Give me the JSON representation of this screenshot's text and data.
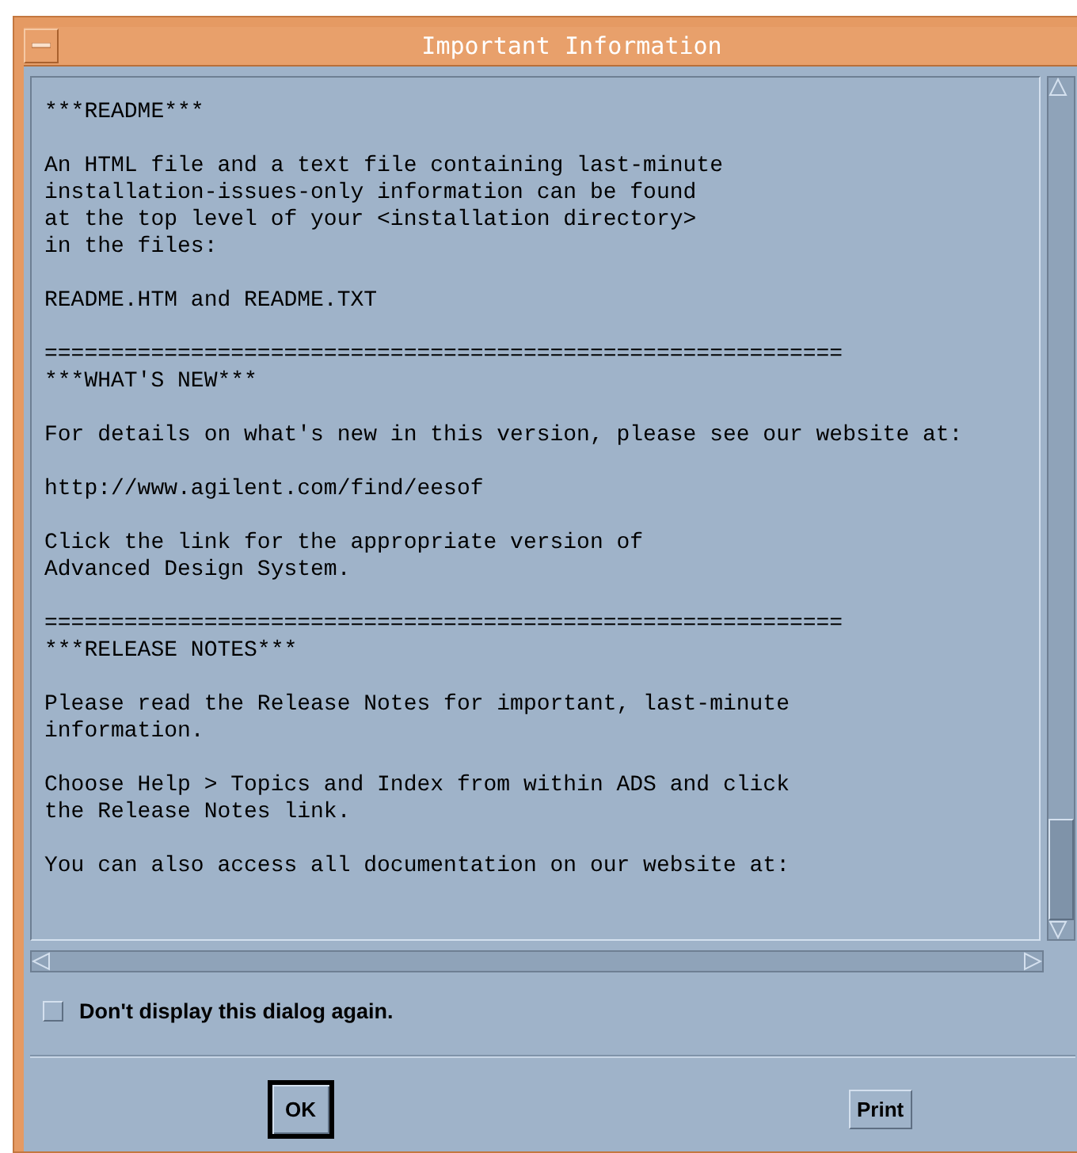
{
  "window": {
    "title": "Important Information"
  },
  "content": [
    {
      "kind": "text",
      "text": "***README***"
    },
    {
      "kind": "text",
      "text": "An HTML file and a text file containing last-minute\ninstallation-issues-only information can be found\nat the top level of your <installation directory>\nin the files:"
    },
    {
      "kind": "text",
      "text": "README.HTM and README.TXT"
    },
    {
      "kind": "rule",
      "text": "============================================================"
    },
    {
      "kind": "heading",
      "text": "***WHAT'S NEW***"
    },
    {
      "kind": "text",
      "text": "For details on what's new in this version, please see our website at:"
    },
    {
      "kind": "link",
      "text": "http://www.agilent.com/find/eesof"
    },
    {
      "kind": "text",
      "text": "Click the link for the appropriate version of\nAdvanced Design System."
    },
    {
      "kind": "rule",
      "text": "============================================================"
    },
    {
      "kind": "heading",
      "text": "***RELEASE NOTES***"
    },
    {
      "kind": "text",
      "text": "Please read the Release Notes for important, last-minute\ninformation."
    },
    {
      "kind": "text",
      "text": "Choose Help > Topics and Index from within ADS and click\nthe Release Notes link."
    },
    {
      "kind": "text",
      "text": "You can also access all documentation on our website at:"
    }
  ],
  "checkbox": {
    "label": "Don't display this dialog again.",
    "checked": false
  },
  "buttons": [
    {
      "label": "OK",
      "default": true
    },
    {
      "label": "Print",
      "default": false
    }
  ]
}
